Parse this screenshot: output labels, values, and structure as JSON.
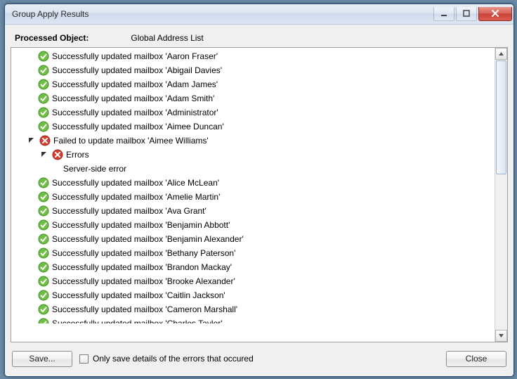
{
  "window": {
    "title": "Group Apply Results"
  },
  "header": {
    "label": "Processed Object:",
    "value": "Global Address List"
  },
  "footer": {
    "save_label": "Save...",
    "checkbox_label": "Only save details of the errors that occured",
    "close_label": "Close"
  },
  "tree": {
    "errors_label": "Errors",
    "error_detail": "Server-side error",
    "items": [
      {
        "status": "ok",
        "text": "Successfully updated mailbox 'Aaron Fraser'"
      },
      {
        "status": "ok",
        "text": "Successfully updated mailbox 'Abigail Davies'"
      },
      {
        "status": "ok",
        "text": "Successfully updated mailbox 'Adam James'"
      },
      {
        "status": "ok",
        "text": "Successfully updated mailbox 'Adam Smith'"
      },
      {
        "status": "ok",
        "text": "Successfully updated mailbox 'Administrator'"
      },
      {
        "status": "ok",
        "text": "Successfully updated mailbox 'Aimee Duncan'"
      },
      {
        "status": "fail",
        "text": "Failed to update mailbox 'Aimee Williams'",
        "expanded": true
      },
      {
        "status": "ok",
        "text": "Successfully updated mailbox 'Alice McLean'"
      },
      {
        "status": "ok",
        "text": "Successfully updated mailbox 'Amelie Martin'"
      },
      {
        "status": "ok",
        "text": "Successfully updated mailbox 'Ava Grant'"
      },
      {
        "status": "ok",
        "text": "Successfully updated mailbox 'Benjamin Abbott'"
      },
      {
        "status": "ok",
        "text": "Successfully updated mailbox 'Benjamin Alexander'"
      },
      {
        "status": "ok",
        "text": "Successfully updated mailbox 'Bethany Paterson'"
      },
      {
        "status": "ok",
        "text": "Successfully updated mailbox 'Brandon Mackay'"
      },
      {
        "status": "ok",
        "text": "Successfully updated mailbox 'Brooke Alexander'"
      },
      {
        "status": "ok",
        "text": "Successfully updated mailbox 'Caitlin Jackson'"
      },
      {
        "status": "ok",
        "text": "Successfully updated mailbox 'Cameron Marshall'"
      },
      {
        "status": "ok",
        "text": "Successfully updated mailbox 'Charles Taylor'",
        "cutoff": true
      }
    ]
  }
}
